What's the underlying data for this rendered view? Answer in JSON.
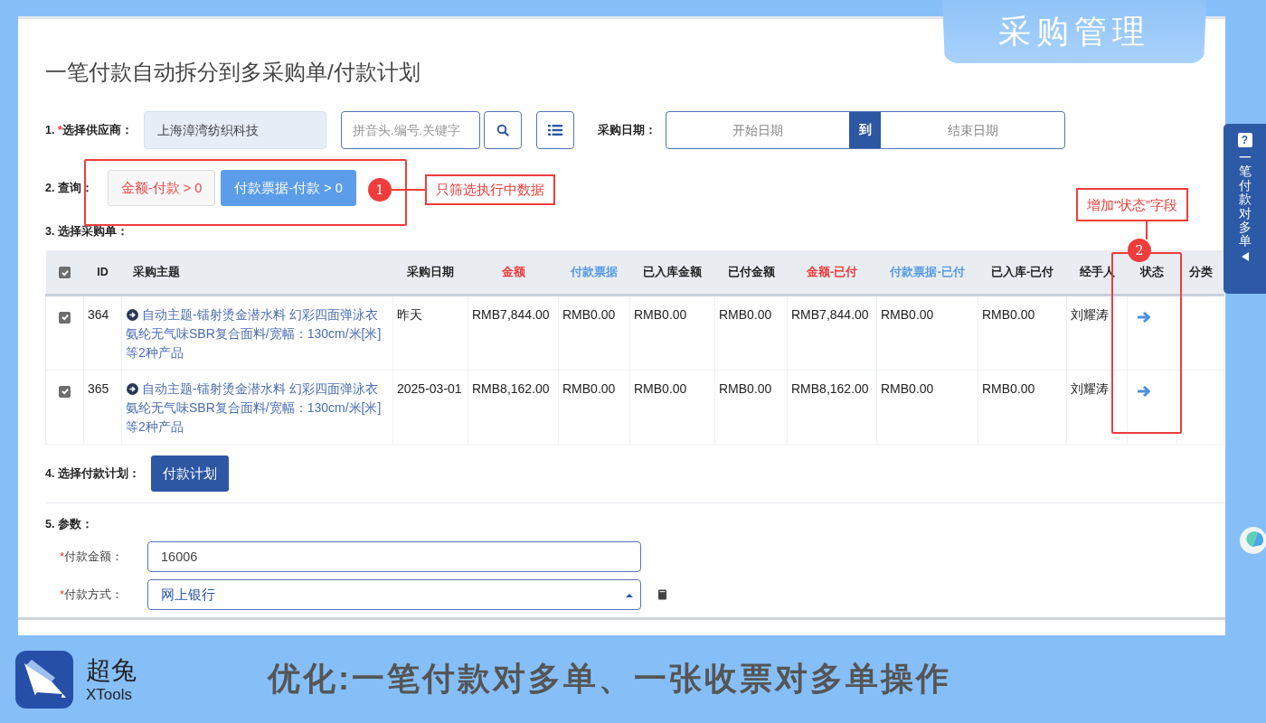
{
  "banner": {
    "title": "采购管理"
  },
  "page": {
    "title": "一笔付款自动拆分到多采购单/付款计划"
  },
  "supplier": {
    "number": "1.",
    "required_mark": "*",
    "label": "选择供应商：",
    "value": "上海漳湾纺织科技",
    "search_placeholder": "拼音头.编号.关键字"
  },
  "date_range": {
    "label": "采购日期：",
    "start_placeholder": "开始日期",
    "separator": "到",
    "end_placeholder": "结束日期"
  },
  "query": {
    "label": "2. 查询：",
    "filters": [
      {
        "label": "金额-付款 > 0",
        "selected": false
      },
      {
        "label": "付款票据-付款 > 0",
        "selected": true
      }
    ]
  },
  "annotations": [
    {
      "number": "1",
      "text": "只筛选执行中数据"
    },
    {
      "number": "2",
      "text": "增加“状态”字段"
    }
  ],
  "table": {
    "label": "3. 选择采购单：",
    "header_checked": true,
    "columns": [
      {
        "label": "ID",
        "kind": "plain"
      },
      {
        "label": "采购主题",
        "kind": "plain"
      },
      {
        "label": "采购日期",
        "kind": "plain"
      },
      {
        "label": "金额",
        "kind": "red"
      },
      {
        "label": "付款票据",
        "kind": "blue"
      },
      {
        "label": "已入库金额",
        "kind": "plain"
      },
      {
        "label": "已付金额",
        "kind": "plain"
      },
      {
        "label": "金额-已付",
        "kind": "red"
      },
      {
        "label": "付款票据-已付",
        "kind": "blue"
      },
      {
        "label": "已入库-已付",
        "kind": "plain"
      },
      {
        "label": "经手人",
        "kind": "plain"
      },
      {
        "label": "状态",
        "kind": "plain"
      },
      {
        "label": "分类",
        "kind": "plain"
      }
    ],
    "rows": [
      {
        "checked": true,
        "cells": [
          "364",
          "自动主题-镭射烫金潜水料 幻彩四面弹泳衣氨纶无气味SBR复合面料/宽幅：130cm/米[米]等2种产品",
          "昨天",
          "RMB7,844.00",
          "RMB0.00",
          "RMB0.00",
          "RMB0.00",
          "RMB7,844.00",
          "RMB0.00",
          "RMB0.00",
          "刘耀涛"
        ]
      },
      {
        "checked": true,
        "cells": [
          "365",
          "自动主题-镭射烫金潜水料 幻彩四面弹泳衣氨纶无气味SBR复合面料/宽幅：130cm/米[米]等2种产品",
          "2025-03-01",
          "RMB8,162.00",
          "RMB0.00",
          "RMB0.00",
          "RMB0.00",
          "RMB8,162.00",
          "RMB0.00",
          "RMB0.00",
          "刘耀涛"
        ]
      }
    ]
  },
  "payment_plan": {
    "label": "4. 选择付款计划：",
    "button": "付款计划"
  },
  "params": {
    "label": "5. 参数：",
    "fields": [
      {
        "required": true,
        "label": "付款金额：",
        "value": "16006",
        "kind": "text"
      },
      {
        "required": true,
        "label": "付款方式：",
        "value": "网上银行",
        "kind": "select"
      }
    ]
  },
  "side_tab": {
    "help": "?",
    "text": "一笔付款对多单"
  },
  "brand": {
    "name": "超兔",
    "sub": "XTools"
  },
  "caption": "优化:一笔付款对多单、一张收票对多单操作"
}
